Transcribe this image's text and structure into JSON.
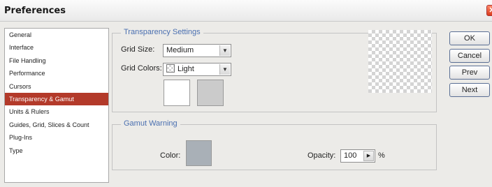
{
  "window": {
    "title": "Preferences"
  },
  "sidebar": {
    "items": [
      {
        "label": "General"
      },
      {
        "label": "Interface"
      },
      {
        "label": "File Handling"
      },
      {
        "label": "Performance"
      },
      {
        "label": "Cursors"
      },
      {
        "label": "Transparency & Gamut",
        "selected": true
      },
      {
        "label": "Units & Rulers"
      },
      {
        "label": "Guides, Grid, Slices & Count"
      },
      {
        "label": "Plug-Ins"
      },
      {
        "label": "Type"
      }
    ]
  },
  "transparency": {
    "group_title": "Transparency Settings",
    "grid_size_label": "Grid Size:",
    "grid_size_value": "Medium",
    "grid_colors_label": "Grid Colors:",
    "grid_colors_value": "Light",
    "color1": "#ffffff",
    "color2": "#cbcbcb"
  },
  "gamut": {
    "group_title": "Gamut Warning",
    "color_label": "Color:",
    "color_value": "#a9b0b7",
    "opacity_label": "Opacity:",
    "opacity_value": "100",
    "opacity_unit": "%"
  },
  "buttons": {
    "ok": "OK",
    "cancel": "Cancel",
    "prev": "Prev",
    "next": "Next"
  },
  "icons": {
    "close": "close-icon",
    "dropdown": "chevron-down-icon",
    "stepper": "chevron-right-icon",
    "swatch": "swatch-light-icon"
  },
  "colors": {
    "selection": "#b33a2a",
    "group_title": "#4a6fb0"
  }
}
